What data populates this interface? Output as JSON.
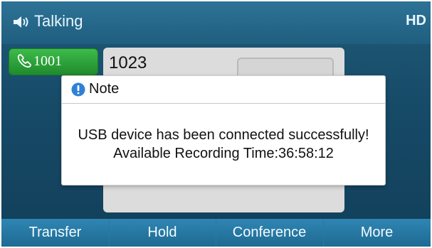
{
  "status_bar": {
    "title": "Talking",
    "right_indicator": "HD"
  },
  "line_key": {
    "label": "1001",
    "color": "#2a9a35"
  },
  "call": {
    "number": "1023"
  },
  "dialog": {
    "title": "Note",
    "message_line1": "USB device has been connected successfully!",
    "message_line2": "Available Recording Time:36:58:12",
    "icon": "info-icon"
  },
  "softkeys": [
    {
      "label": "Transfer"
    },
    {
      "label": "Hold"
    },
    {
      "label": "Conference"
    },
    {
      "label": "More"
    }
  ],
  "icons": {
    "status": "speaker-icon",
    "line": "phone-icon",
    "contact": "avatar-placeholder"
  },
  "colors": {
    "background": "#164a67",
    "softkey_bar": "#2b7aa6",
    "dialog_bg": "#ffffff",
    "info_icon": "#2f80d6"
  }
}
